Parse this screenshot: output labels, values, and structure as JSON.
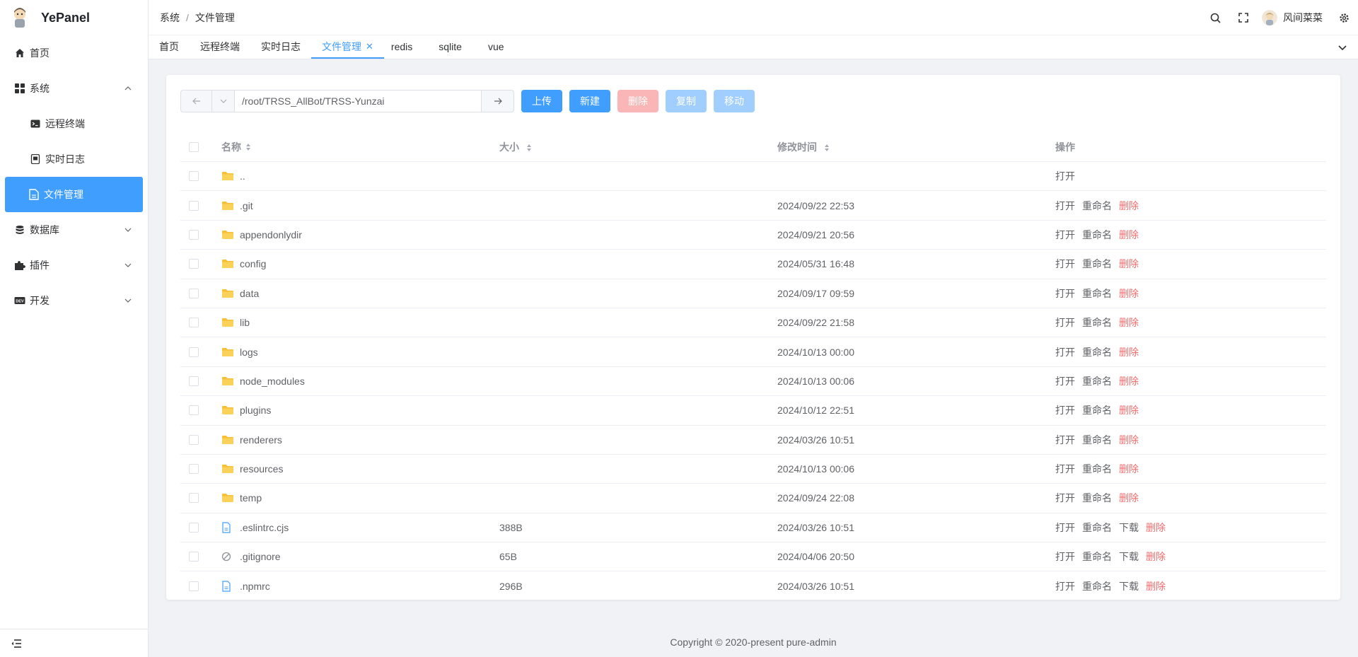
{
  "app": {
    "name": "YePanel"
  },
  "sidebar": {
    "items": [
      {
        "label": "首页",
        "icon": "home-icon"
      },
      {
        "label": "系统",
        "icon": "grid-icon"
      },
      {
        "label": "远程终端",
        "icon": "terminal-icon"
      },
      {
        "label": "实时日志",
        "icon": "log-icon"
      },
      {
        "label": "文件管理",
        "icon": "file-icon"
      },
      {
        "label": "数据库",
        "icon": "database-icon"
      },
      {
        "label": "插件",
        "icon": "puzzle-icon"
      },
      {
        "label": "开发",
        "icon": "dev-icon"
      }
    ]
  },
  "header": {
    "breadcrumb": [
      "系统",
      "文件管理"
    ],
    "user": "风间菜菜"
  },
  "tabs": [
    "首页",
    "远程终端",
    "实时日志",
    "文件管理",
    "redis",
    "sqlite",
    "vue"
  ],
  "toolbar": {
    "path": "/root/TRSS_AllBot/TRSS-Yunzai",
    "upload": "上传",
    "new": "新建",
    "delete": "删除",
    "copy": "复制",
    "move": "移动"
  },
  "table": {
    "headers": {
      "name": "名称",
      "size": "大小",
      "time": "修改时间",
      "ops": "操作"
    },
    "op_labels": {
      "open": "打开",
      "rename": "重命名",
      "download": "下载",
      "delete": "删除"
    },
    "rows": [
      {
        "name": "..",
        "type": "folder",
        "size": "",
        "time": "",
        "ops": [
          "open"
        ]
      },
      {
        "name": ".git",
        "type": "folder",
        "size": "",
        "time": "2024/09/22 22:53",
        "ops": [
          "open",
          "rename",
          "delete"
        ]
      },
      {
        "name": "appendonlydir",
        "type": "folder",
        "size": "",
        "time": "2024/09/21 20:56",
        "ops": [
          "open",
          "rename",
          "delete"
        ]
      },
      {
        "name": "config",
        "type": "folder",
        "size": "",
        "time": "2024/05/31 16:48",
        "ops": [
          "open",
          "rename",
          "delete"
        ]
      },
      {
        "name": "data",
        "type": "folder",
        "size": "",
        "time": "2024/09/17 09:59",
        "ops": [
          "open",
          "rename",
          "delete"
        ]
      },
      {
        "name": "lib",
        "type": "folder",
        "size": "",
        "time": "2024/09/22 21:58",
        "ops": [
          "open",
          "rename",
          "delete"
        ]
      },
      {
        "name": "logs",
        "type": "folder",
        "size": "",
        "time": "2024/10/13 00:00",
        "ops": [
          "open",
          "rename",
          "delete"
        ]
      },
      {
        "name": "node_modules",
        "type": "folder",
        "size": "",
        "time": "2024/10/13 00:06",
        "ops": [
          "open",
          "rename",
          "delete"
        ]
      },
      {
        "name": "plugins",
        "type": "folder",
        "size": "",
        "time": "2024/10/12 22:51",
        "ops": [
          "open",
          "rename",
          "delete"
        ]
      },
      {
        "name": "renderers",
        "type": "folder",
        "size": "",
        "time": "2024/03/26 10:51",
        "ops": [
          "open",
          "rename",
          "delete"
        ]
      },
      {
        "name": "resources",
        "type": "folder",
        "size": "",
        "time": "2024/10/13 00:06",
        "ops": [
          "open",
          "rename",
          "delete"
        ]
      },
      {
        "name": "temp",
        "type": "folder",
        "size": "",
        "time": "2024/09/24 22:08",
        "ops": [
          "open",
          "rename",
          "delete"
        ]
      },
      {
        "name": ".eslintrc.cjs",
        "type": "file",
        "size": "388B",
        "time": "2024/03/26 10:51",
        "ops": [
          "open",
          "rename",
          "download",
          "delete"
        ]
      },
      {
        "name": ".gitignore",
        "type": "blocked",
        "size": "65B",
        "time": "2024/04/06 20:50",
        "ops": [
          "open",
          "rename",
          "download",
          "delete"
        ]
      },
      {
        "name": ".npmrc",
        "type": "file",
        "size": "296B",
        "time": "2024/03/26 10:51",
        "ops": [
          "open",
          "rename",
          "download",
          "delete"
        ]
      }
    ]
  },
  "footer": {
    "text": "Copyright © 2020-present pure-admin"
  },
  "colors": {
    "primary": "#409eff",
    "danger": "#f56c6c",
    "folder": "#f7c034"
  }
}
